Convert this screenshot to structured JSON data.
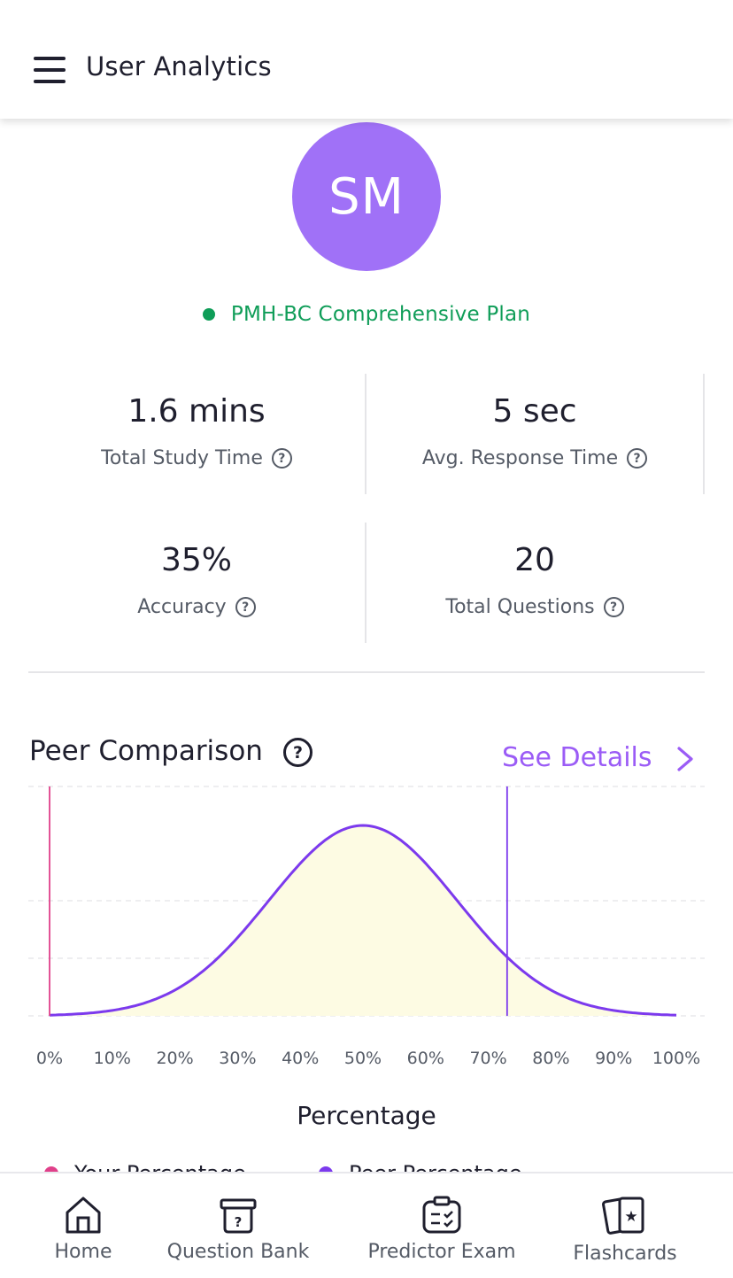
{
  "header": {
    "title": "User Analytics",
    "menu_icon": "menu-icon"
  },
  "profile": {
    "initials": "SM",
    "avatar_color": "#a071f7",
    "plan_name": "PMH-BC Comprehensive Plan",
    "plan_status_color": "#0f9d58"
  },
  "stats": [
    {
      "value": "1.6 mins",
      "label": "Total Study Time"
    },
    {
      "value": "5 sec",
      "label": "Avg. Response Time"
    },
    {
      "value": "35%",
      "label": "Accuracy"
    },
    {
      "value": "20",
      "label": "Total Questions"
    }
  ],
  "peer": {
    "title": "Peer Comparison",
    "see_details": "See Details"
  },
  "chart_data": {
    "type": "area",
    "xlabel": "Percentage",
    "ylabel": "",
    "x_ticks": [
      "0%",
      "10%",
      "20%",
      "30%",
      "40%",
      "50%",
      "60%",
      "70%",
      "80%",
      "90%",
      "100%"
    ],
    "xlim": [
      0,
      100
    ],
    "distribution": {
      "shape": "normal",
      "mean": 50,
      "std": 15
    },
    "markers": [
      {
        "name": "Your Percentage",
        "x": 0,
        "color": "#e0408a"
      },
      {
        "name": "Peer Percentage",
        "x": 73,
        "color": "#7c3aed"
      }
    ],
    "grid": true,
    "colors": {
      "curve": "#7c3aed",
      "fill": "#fdfbe3"
    },
    "legend_position": "bottom"
  },
  "legend": [
    {
      "label": "Your Percentage",
      "color": "#e0408a"
    },
    {
      "label": "Peer Percentage",
      "color": "#7c3aed"
    }
  ],
  "nav": [
    {
      "label": "Home",
      "icon": "home-icon"
    },
    {
      "label": "Question Bank",
      "icon": "question-bank-icon"
    },
    {
      "label": "Predictor Exam",
      "icon": "predictor-exam-icon"
    },
    {
      "label": "Flashcards",
      "icon": "flashcards-icon"
    }
  ]
}
